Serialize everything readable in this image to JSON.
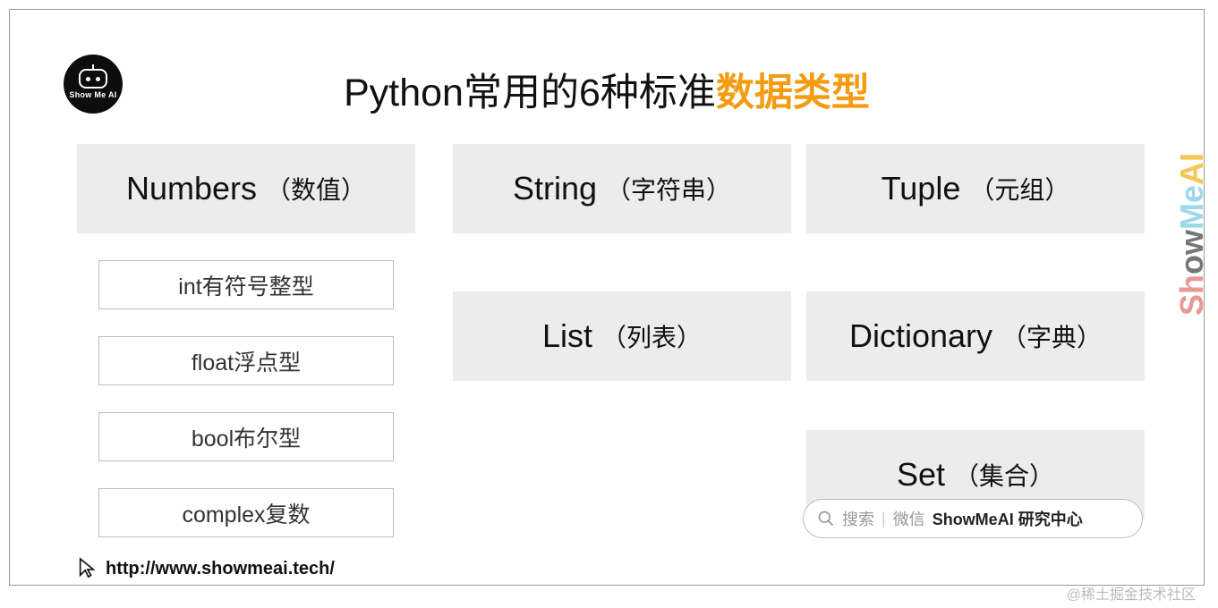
{
  "logo": {
    "label": "Show Me AI"
  },
  "title": {
    "prefix": "Python常用的6种标准",
    "accent": "数据类型"
  },
  "types": {
    "numbers": {
      "en": "Numbers",
      "zh": "（数值）",
      "subtypes": [
        "int有符号整型",
        "float浮点型",
        "bool布尔型",
        "complex复数"
      ]
    },
    "string": {
      "en": "String",
      "zh": "（字符串）"
    },
    "list": {
      "en": "List",
      "zh": "（列表）"
    },
    "tuple": {
      "en": "Tuple",
      "zh": "（元组）"
    },
    "dictionary": {
      "en": "Dictionary",
      "zh": "（字典）"
    },
    "set": {
      "en": "Set",
      "zh": "（集合）"
    }
  },
  "footer": {
    "url": "http://www.showmeai.tech/"
  },
  "search": {
    "prompt1": "搜索",
    "prompt2": "微信",
    "brand": "ShowMeAI 研究中心"
  },
  "watermark": "ShowMeAI",
  "credit": "@稀土掘金技术社区"
}
